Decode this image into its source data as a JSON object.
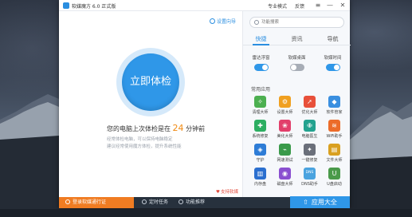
{
  "window": {
    "title": "软媒魔方 6.0 正式版",
    "menu_pro": "专业模式",
    "menu_feedback": "反馈",
    "menu_more": "≡",
    "btn_minimize": "—",
    "btn_close": "✕"
  },
  "left": {
    "settings_link": "设置向导",
    "exam_button": "立即体检",
    "last_check_prefix": "您的电脑上次体检是在",
    "last_check_value": "24",
    "last_check_suffix": "分钟前",
    "tip_line1": "经常体检电脑，可以保持电脑稳定",
    "tip_line2": "建议经常使用魔方体检，提升系统性能",
    "support": "支持软媒"
  },
  "right": {
    "search_placeholder": "功能搜索",
    "tabs": [
      "快捷",
      "资讯",
      "导航"
    ],
    "toggles": [
      {
        "label": "雷达浮窗",
        "state": "on"
      },
      {
        "label": "软媒桌面",
        "state": "off"
      },
      {
        "label": "软媒时间",
        "state": "on"
      }
    ],
    "section_title": "常用应用",
    "apps": [
      {
        "label": "清理大师",
        "icon": "broom-icon",
        "color": "#4caf50",
        "glyph": "✧"
      },
      {
        "label": "设置大师",
        "icon": "gear-icon",
        "color": "#f0a020",
        "glyph": "⚙"
      },
      {
        "label": "优化大师",
        "icon": "rocket-icon",
        "color": "#e8503a",
        "glyph": "➚"
      },
      {
        "label": "软件管家",
        "icon": "package-icon",
        "color": "#3a8fe0",
        "glyph": "◆"
      },
      {
        "label": "系统修复",
        "icon": "repair-icon",
        "color": "#2cae62",
        "glyph": "✚"
      },
      {
        "label": "美化大师",
        "icon": "palette-icon",
        "color": "#e23f6b",
        "glyph": "❀"
      },
      {
        "label": "电脑医生",
        "icon": "medkit-icon",
        "color": "#23a28f",
        "glyph": "✙"
      },
      {
        "label": "WiFi助手",
        "icon": "wifi-icon",
        "color": "#ec6c2a",
        "glyph": "≋"
      },
      {
        "label": "守护",
        "icon": "shield-icon",
        "color": "#2e7cd6",
        "glyph": "◈"
      },
      {
        "label": "网速测试",
        "icon": "speed-icon",
        "color": "#3a9a4a",
        "glyph": "⌁"
      },
      {
        "label": "一键修复",
        "icon": "wrench-icon",
        "color": "#6a6f7a",
        "glyph": "✦"
      },
      {
        "label": "文件大师",
        "icon": "folder-icon",
        "color": "#d9a020",
        "glyph": "▤"
      },
      {
        "label": "内存盘",
        "icon": "ram-icon",
        "color": "#2b6fcf",
        "glyph": "▥"
      },
      {
        "label": "磁盘大师",
        "icon": "disk-icon",
        "color": "#8a4fd0",
        "glyph": "◉"
      },
      {
        "label": "DNS助手",
        "icon": "dns-icon",
        "color": "#4aa3df",
        "glyph": "DNS"
      },
      {
        "label": "U盘启动",
        "icon": "usb-icon",
        "color": "#4a9a4a",
        "glyph": "U"
      }
    ]
  },
  "bottom": {
    "login": "登录软媒通行证",
    "schedule": "定时任务",
    "upgrade": "功能推荐",
    "all_apps": "应用大全"
  }
}
